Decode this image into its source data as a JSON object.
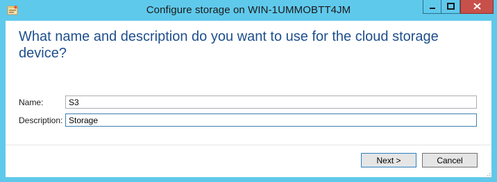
{
  "window": {
    "title": "Configure storage on WIN-1UMMOBTT4JM",
    "app_icon": "wizard-window-icon",
    "controls": {
      "minimize_icon": "minimize-icon",
      "maximize_icon": "maximize-icon",
      "close_icon": "close-icon"
    }
  },
  "page": {
    "heading": "What name and description do you want to use for the cloud storage device?"
  },
  "form": {
    "name_label": "Name:",
    "name_value": "S3",
    "description_label": "Description:",
    "description_value": "Storage"
  },
  "buttons": {
    "next_label": "Next >",
    "cancel_label": "Cancel"
  },
  "colors": {
    "title_bar": "#5fc9ec",
    "heading_text": "#1e4f8c",
    "close_button": "#c7504a"
  }
}
